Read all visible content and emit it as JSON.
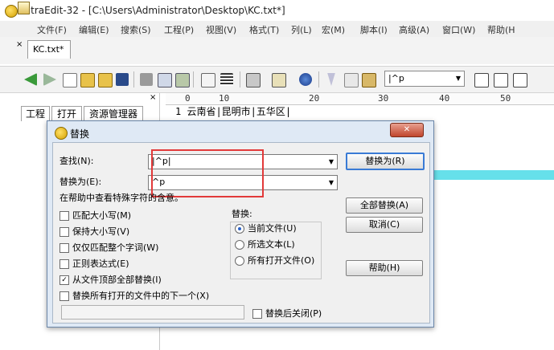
{
  "window": {
    "title": "UltraEdit-32 - [C:\\Users\\Administrator\\Desktop\\KC.txt*]"
  },
  "menu": [
    "文件(F)",
    "编辑(E)",
    "搜索(S)",
    "工程(P)",
    "视图(V)",
    "格式(T)",
    "列(L)",
    "宏(M)",
    "脚本(I)",
    "高级(A)",
    "窗口(W)",
    "帮助(H"
  ],
  "tab": {
    "label": "KC.txt*",
    "close": "×"
  },
  "toolbar": {
    "search_value": "|^p"
  },
  "left_panel": {
    "tabs": [
      "工程",
      "打开",
      "资源管理器"
    ],
    "close": "×"
  },
  "ruler": {
    "marks": [
      "0",
      "10",
      "20",
      "30",
      "40",
      "50"
    ]
  },
  "editor": {
    "line1": "1 云南省|昆明市|五华区|"
  },
  "dialog": {
    "title": "替换",
    "close": "✕",
    "find_label": "查找(N):",
    "find_value": "|^p|",
    "replace_label": "替换为(E):",
    "replace_value": "^p",
    "hint": "在帮助中查看特殊字符的含意。",
    "options": [
      {
        "label": "匹配大小写(M)",
        "checked": false
      },
      {
        "label": "保持大小写(V)",
        "checked": false
      },
      {
        "label": "仅仅匹配整个字词(W)",
        "checked": false
      },
      {
        "label": "正则表达式(E)",
        "checked": false
      },
      {
        "label": "从文件顶部全部替换(I)",
        "checked": true
      },
      {
        "label": "替换所有打开的文件中的下一个(X)",
        "checked": false
      }
    ],
    "scope_title": "替换:",
    "scope": [
      {
        "label": "当前文件(U)",
        "selected": true
      },
      {
        "label": "所选文本(L)",
        "selected": false
      },
      {
        "label": "所有打开文件(O)",
        "selected": false
      }
    ],
    "buttons": {
      "replace_with": "替换为(R)",
      "replace_all": "全部替换(A)",
      "cancel": "取消(C)",
      "help": "帮助(H)"
    },
    "close_after": "替换后关闭(P)",
    "check_mark": "✓",
    "arrow": "▼"
  }
}
